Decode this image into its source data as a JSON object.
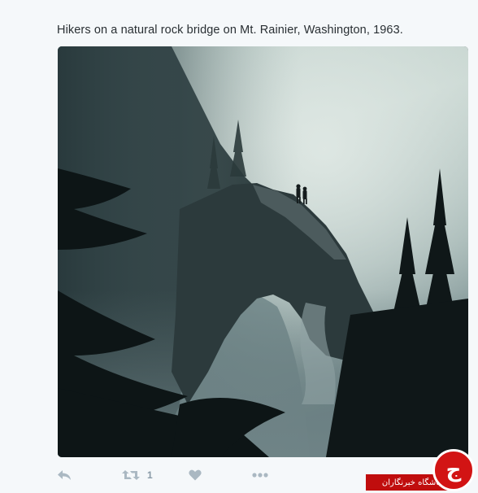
{
  "tweet": {
    "text": "Hikers on a natural rock bridge on Mt. Rainier, Washington, 1963."
  },
  "actions": {
    "reply_icon": "reply-icon",
    "retweet_icon": "retweet-icon",
    "retweet_count": "1",
    "like_icon": "heart-icon",
    "more_icon": "more-dots-icon"
  },
  "watermark": {
    "text": "باشگاه خبرنگاران",
    "logo_glyph": "ج"
  },
  "colors": {
    "background": "#f5f8fa",
    "text": "#292f33",
    "icon": "#aab8c2",
    "watermark_red": "#c00d0d"
  }
}
